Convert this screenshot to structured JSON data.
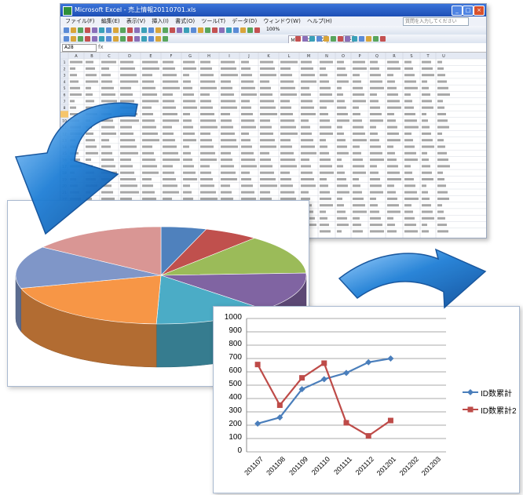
{
  "excel": {
    "window_title": "Microsoft Excel - 売上情報20110701.xls",
    "menu": [
      "ファイル(F)",
      "編集(E)",
      "表示(V)",
      "挿入(I)",
      "書式(O)",
      "ツール(T)",
      "データ(D)",
      "ウィンドウ(W)",
      "ヘルプ(H)"
    ],
    "help_placeholder": "質問を入力してください",
    "name_box": "A28",
    "zoom": "100%",
    "font_name": "ＭＳ Ｐゴシック",
    "font_size": "11",
    "columns": [
      "A",
      "B",
      "C",
      "D",
      "E",
      "F",
      "G",
      "H",
      "I",
      "J",
      "K",
      "L",
      "M",
      "N",
      "O",
      "P",
      "Q",
      "R",
      "S",
      "T",
      "U"
    ],
    "row_count": 27
  },
  "line_chart": {
    "chart_data": {
      "type": "line",
      "categories": [
        "201107",
        "201108",
        "201109",
        "201110",
        "201111",
        "201112",
        "201201",
        "201202",
        "201203"
      ],
      "series": [
        {
          "name": "ID数累計",
          "values": [
            212,
            258,
            470,
            545,
            592,
            672,
            700,
            null,
            null
          ],
          "color": "#4a7ebb",
          "marker": "diamond"
        },
        {
          "name": "ID数累計2",
          "values": [
            655,
            350,
            555,
            665,
            218,
            120,
            235,
            null,
            null
          ],
          "color": "#be4b48",
          "marker": "square"
        }
      ],
      "ylim": [
        0,
        1000
      ],
      "yticks": [
        "0",
        "100",
        "200",
        "300",
        "400",
        "500",
        "600",
        "700",
        "800",
        "900",
        "1000"
      ],
      "grid": true,
      "legend": "right"
    }
  },
  "pie_chart": {
    "chart_data": {
      "type": "pie",
      "values": [
        5,
        6,
        13,
        13,
        13,
        20,
        14,
        15
      ],
      "colors": [
        "#4f81bd",
        "#c0504d",
        "#9bbb59",
        "#8064a2",
        "#4bacc6",
        "#f79646",
        "#7f96c8",
        "#d99694"
      ]
    }
  },
  "colors": {
    "arrow_blue": "#1f7fd6",
    "series1": "#4a7ebb",
    "series2": "#be4b48"
  }
}
